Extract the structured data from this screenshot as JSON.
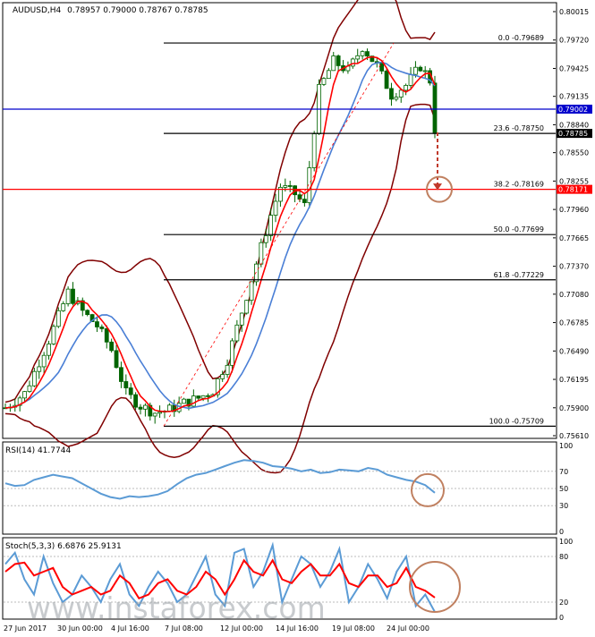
{
  "chart_data": [
    {
      "type": "candlestick",
      "panel": "price",
      "title": "AUDUSD,H4",
      "header_ohlc": "0.78957 0.79000 0.78767 0.78785",
      "ylim": [
        0.7561,
        0.8008
      ],
      "yticks": [
        "0.80015",
        "0.79720",
        "0.79425",
        "0.79135",
        "0.78840",
        "0.78550",
        "0.78255",
        "0.77960",
        "0.77665",
        "0.77370",
        "0.77080",
        "0.76785",
        "0.76490",
        "0.76195",
        "0.75900",
        "0.75610"
      ],
      "xlabels": [
        "27 Jun 2017",
        "30 Jun 00:00",
        "4 Jul 16:00",
        "7 Jul 08:00",
        "12 Jul 00:00",
        "14 Jul 16:00",
        "19 Jul 08:00",
        "24 Jul 00:00"
      ],
      "price_path": [
        [
          0,
          0.759
        ],
        [
          4,
          0.7605
        ],
        [
          9,
          0.766
        ],
        [
          13,
          0.771
        ],
        [
          16,
          0.769
        ],
        [
          19,
          0.7675
        ],
        [
          22,
          0.765
        ],
        [
          25,
          0.7605
        ],
        [
          28,
          0.7592
        ],
        [
          31,
          0.7585
        ],
        [
          34,
          0.7588
        ],
        [
          37,
          0.7595
        ],
        [
          40,
          0.76
        ],
        [
          43,
          0.7608
        ],
        [
          46,
          0.764
        ],
        [
          49,
          0.769
        ],
        [
          52,
          0.774
        ],
        [
          55,
          0.779
        ],
        [
          57,
          0.782
        ],
        [
          60,
          0.7812
        ],
        [
          62,
          0.78
        ],
        [
          65,
          0.792
        ],
        [
          68,
          0.795
        ],
        [
          71,
          0.794
        ],
        [
          74,
          0.7965
        ],
        [
          77,
          0.7945
        ],
        [
          80,
          0.7915
        ],
        [
          83,
          0.7925
        ],
        [
          86,
          0.7945
        ],
        [
          88,
          0.793
        ],
        [
          89,
          0.7879
        ]
      ],
      "levels": [
        {
          "label": "0.0 -0.79689",
          "value": 0.79689,
          "color": "#000000",
          "tag": ""
        },
        {
          "label": "23.6 -0.78750",
          "value": 0.7875,
          "color": "#000000",
          "tag": "0.78785"
        },
        {
          "label": "38.2 -0.78169",
          "value": 0.78169,
          "color": "#ff0000",
          "tag": "0.78171"
        },
        {
          "label": "50.0 -0.77699",
          "value": 0.77699,
          "color": "#000000",
          "tag": ""
        },
        {
          "label": "61.8 -0.77229",
          "value": 0.77229,
          "color": "#000000",
          "tag": ""
        },
        {
          "label": "100.0 -0.75709",
          "value": 0.75709,
          "color": "#000000",
          "tag": ""
        }
      ],
      "blue_line": {
        "value": 0.79002,
        "tag": "0.79002",
        "color": "#0000cc"
      },
      "colors": {
        "candle": "#006400",
        "ma_fast": "#ff0000",
        "ma_slow": "#4a7fd6",
        "bands": "#800000",
        "annotation": "#c0392b",
        "circle": "#c08060"
      }
    },
    {
      "type": "line",
      "panel": "rsi",
      "label": "RSI(14) 41.7744",
      "ylim": [
        0,
        100
      ],
      "yticks": [
        "100",
        "70",
        "50",
        "30",
        "0"
      ],
      "values": [
        56,
        53,
        54,
        60,
        63,
        66,
        64,
        62,
        56,
        50,
        44,
        40,
        38,
        41,
        40,
        41,
        43,
        47,
        55,
        62,
        66,
        68,
        72,
        76,
        80,
        83,
        82,
        80,
        76,
        75,
        73,
        70,
        72,
        68,
        69,
        72,
        71,
        70,
        74,
        72,
        66,
        63,
        60,
        58,
        54,
        45
      ],
      "color": "#5b9bd5"
    },
    {
      "type": "line",
      "panel": "stoch",
      "label": "Stoch(5,3,3) 6.6876 25.9131",
      "ylim": [
        0,
        100
      ],
      "yticks": [
        "100",
        "80",
        "20",
        "0"
      ],
      "main": [
        70,
        85,
        50,
        30,
        80,
        45,
        20,
        30,
        55,
        40,
        20,
        50,
        70,
        30,
        15,
        40,
        60,
        45,
        20,
        30,
        55,
        80,
        30,
        15,
        85,
        90,
        40,
        60,
        95,
        20,
        50,
        80,
        70,
        40,
        60,
        90,
        20,
        40,
        70,
        50,
        25,
        60,
        80,
        15,
        30,
        7
      ],
      "signal": [
        60,
        70,
        72,
        55,
        60,
        65,
        40,
        30,
        35,
        40,
        30,
        35,
        55,
        45,
        25,
        30,
        45,
        50,
        35,
        30,
        40,
        60,
        50,
        30,
        50,
        75,
        60,
        55,
        75,
        50,
        45,
        60,
        70,
        55,
        55,
        70,
        45,
        40,
        55,
        55,
        40,
        45,
        65,
        40,
        35,
        26
      ],
      "colors": {
        "main": "#5b9bd5",
        "signal": "#ff0000"
      }
    }
  ],
  "watermark": "www.instaforex.com"
}
